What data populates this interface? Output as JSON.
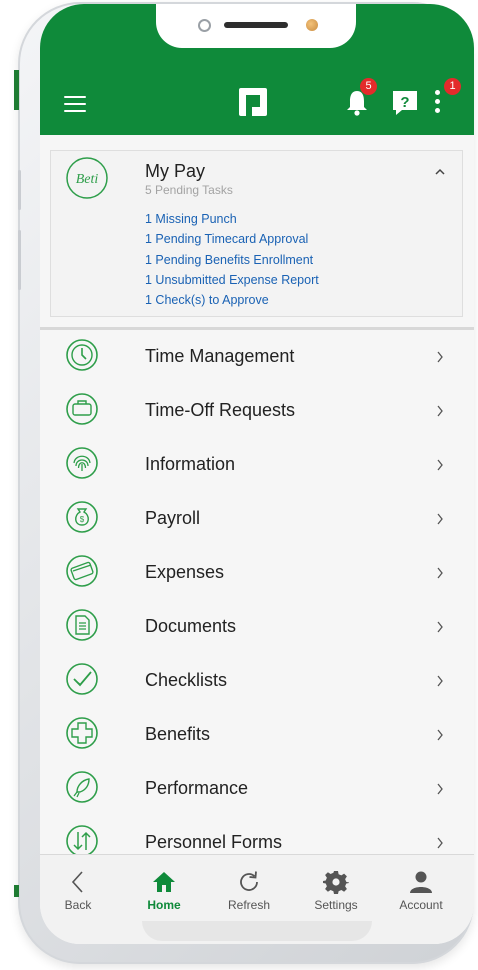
{
  "header": {
    "notification_count": "5",
    "more_count": "1",
    "icons": [
      "menu-icon",
      "logo-icon",
      "bell-icon",
      "help-icon",
      "more-vertical-icon"
    ],
    "brand_color": "#0f8a3a"
  },
  "my_pay": {
    "icon_text": "Beti",
    "title": "My Pay",
    "subtitle": "5 Pending Tasks",
    "tasks": [
      "1 Missing Punch",
      "1 Pending Timecard Approval",
      "1 Pending Benefits Enrollment",
      "1 Unsubmitted Expense Report",
      "1 Check(s) to Approve"
    ],
    "link_color": "#1a62b4"
  },
  "menu": [
    {
      "label": "Time Management",
      "icon": "clock-icon"
    },
    {
      "label": "Time-Off Requests",
      "icon": "suitcase-icon"
    },
    {
      "label": "Information",
      "icon": "fingerprint-icon"
    },
    {
      "label": "Payroll",
      "icon": "money-bag-icon"
    },
    {
      "label": "Expenses",
      "icon": "credit-card-icon"
    },
    {
      "label": "Documents",
      "icon": "document-icon"
    },
    {
      "label": "Checklists",
      "icon": "checklist-icon"
    },
    {
      "label": "Benefits",
      "icon": "medical-cross-icon"
    },
    {
      "label": "Performance",
      "icon": "rocket-icon"
    },
    {
      "label": "Personnel Forms",
      "icon": "transfer-arrows-icon"
    }
  ],
  "bottom_nav": [
    {
      "label": "Back",
      "icon": "back-icon"
    },
    {
      "label": "Home",
      "icon": "home-icon",
      "active": true
    },
    {
      "label": "Refresh",
      "icon": "refresh-icon"
    },
    {
      "label": "Settings",
      "icon": "gear-icon"
    },
    {
      "label": "Account",
      "icon": "user-icon"
    }
  ]
}
